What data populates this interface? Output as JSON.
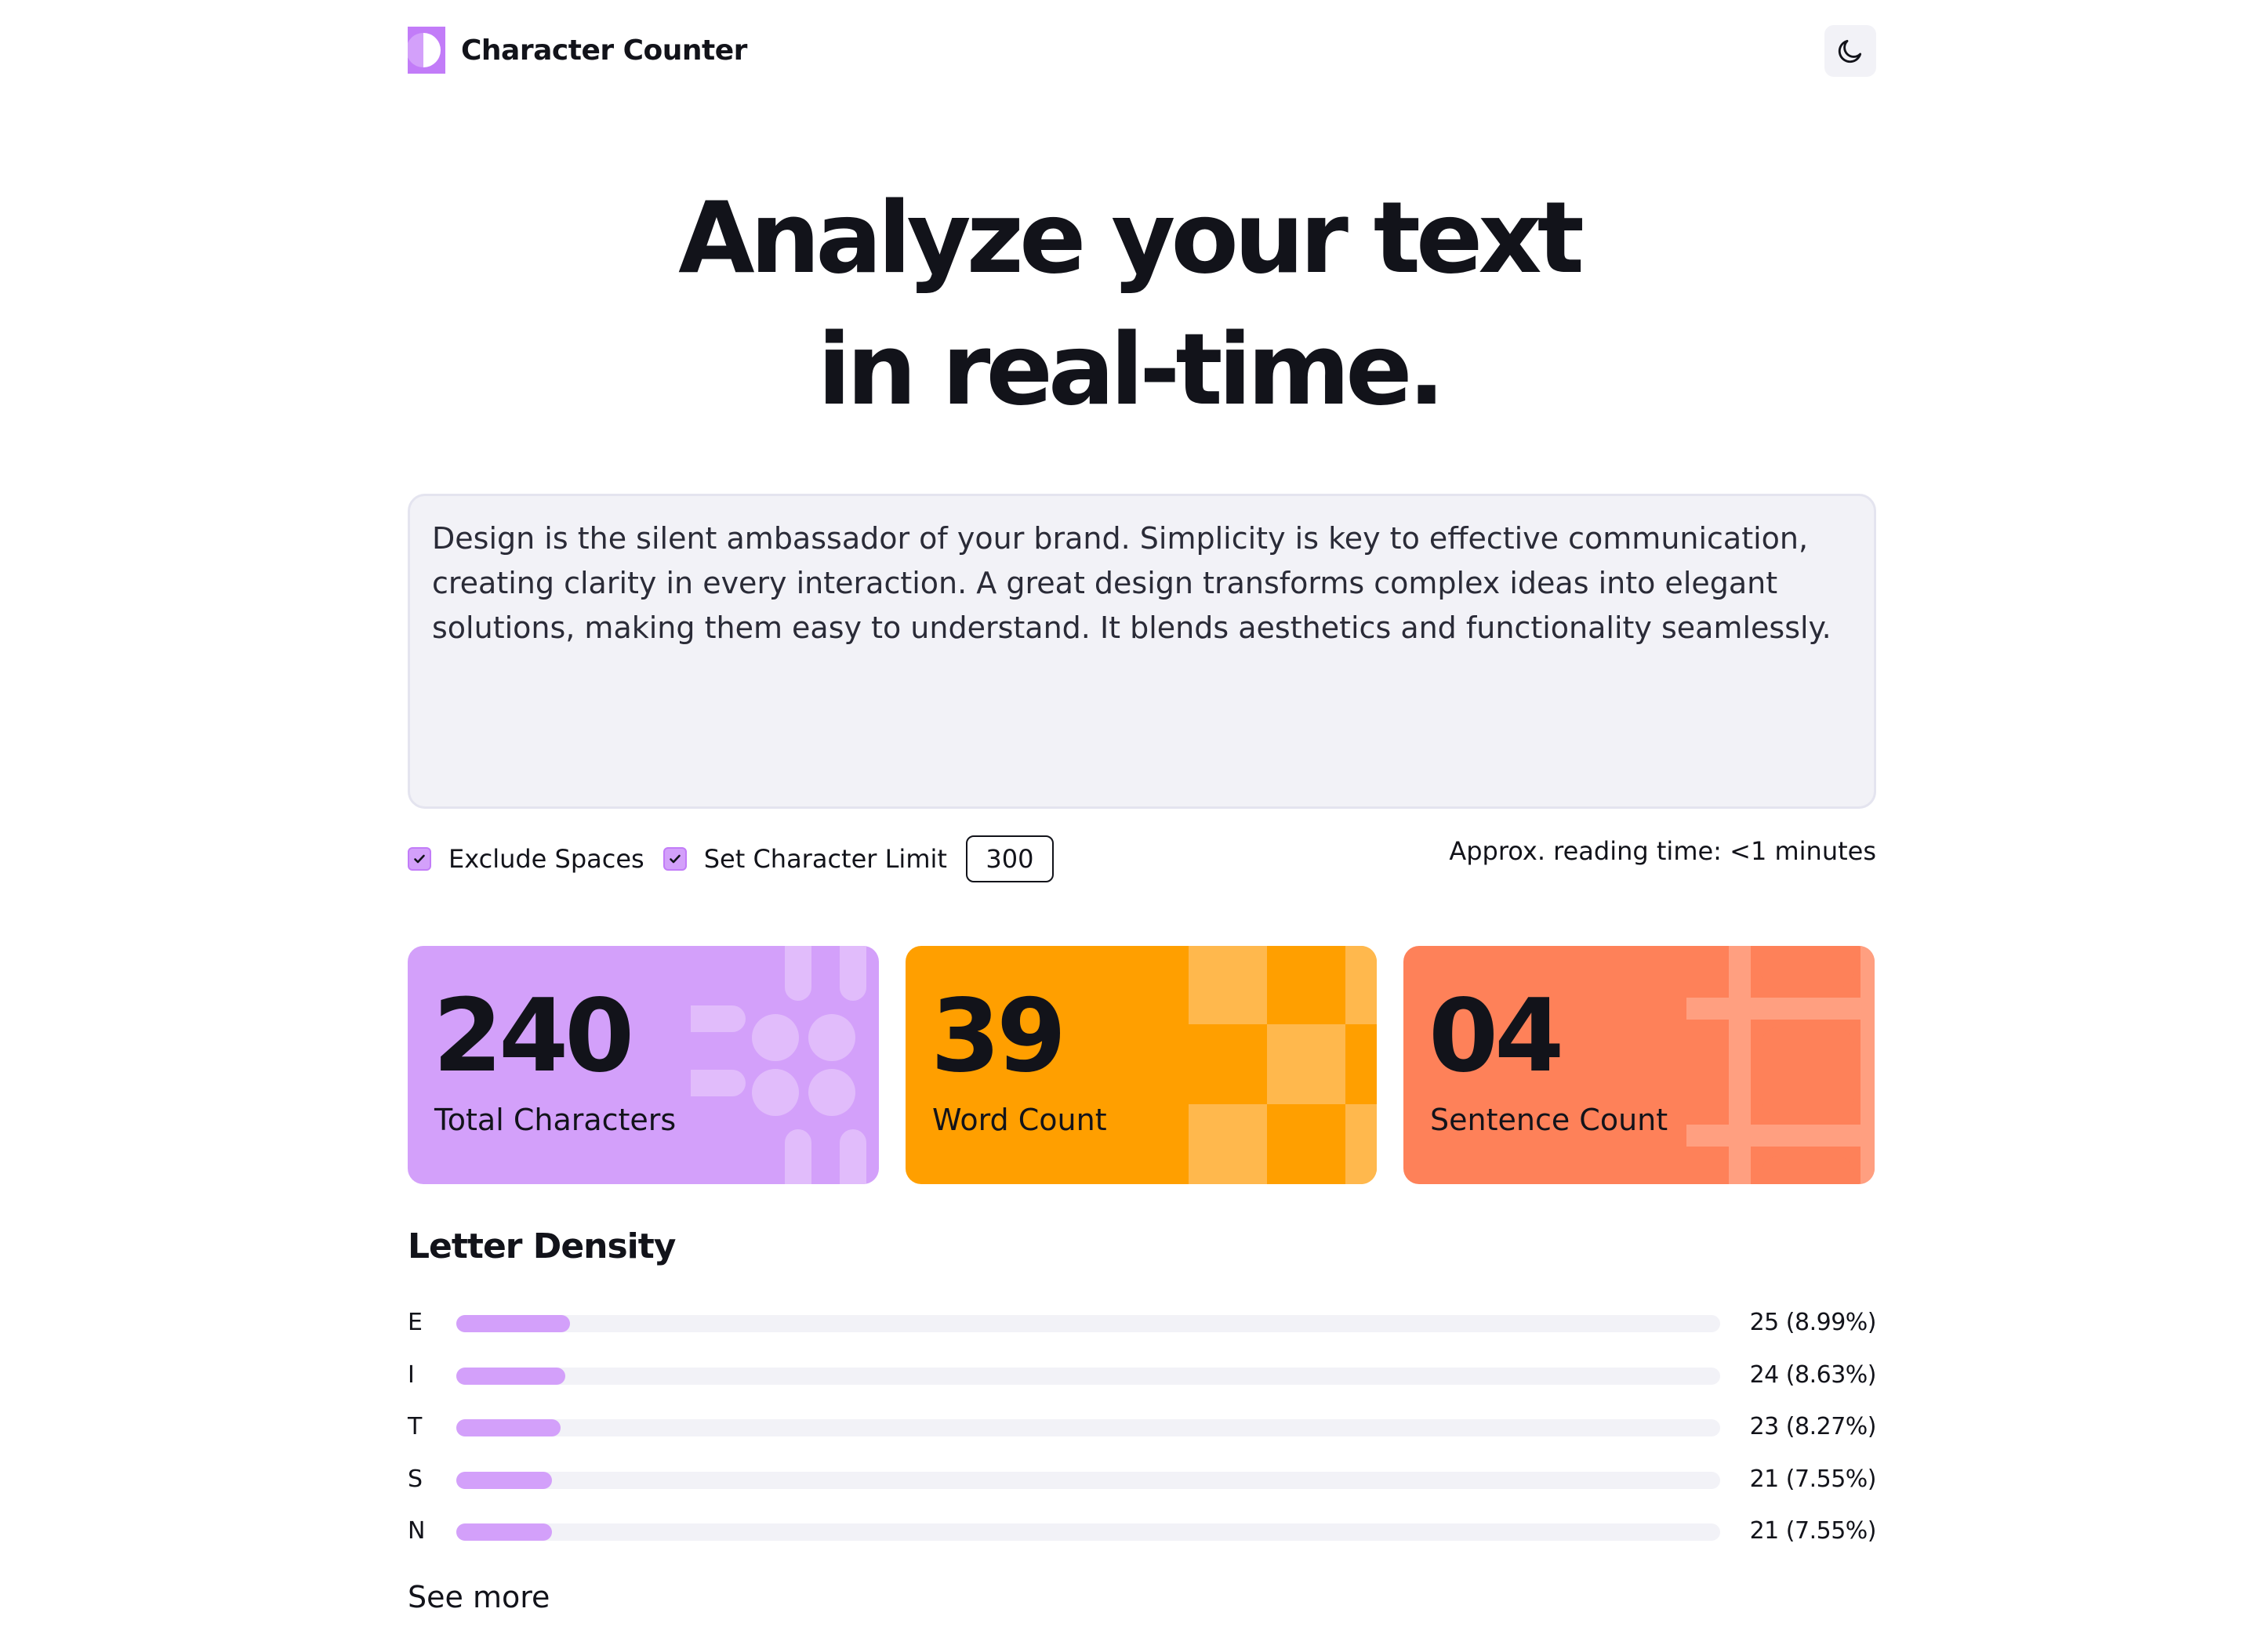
{
  "header": {
    "app_title": "Character Counter",
    "logo_icon": "half-moon-logo-icon",
    "theme_toggle_icon": "moon-icon"
  },
  "hero": {
    "line1": "Analyze your text",
    "line2": "in real-time."
  },
  "editor": {
    "text": "Design is the silent ambassador of your brand. Simplicity is key to effective communication, creating clarity in every interaction. A great design transforms complex ideas into elegant solutions, making them easy to understand. It blends aesthetics and functionality seamlessly."
  },
  "options": {
    "exclude_spaces_label": "Exclude Spaces",
    "exclude_spaces_checked": true,
    "char_limit_label": "Set Character Limit",
    "char_limit_checked": true,
    "char_limit_value": "300",
    "reading_time": "Approx. reading time: <1 minutes"
  },
  "stats": [
    {
      "value": "240",
      "label": "Total Characters",
      "color": "#d3a0fa"
    },
    {
      "value": "39",
      "label": "Word Count",
      "color": "#ff9f00"
    },
    {
      "value": "04",
      "label": "Sentence Count",
      "color": "#fe8159"
    }
  ],
  "density": {
    "title": "Letter Density",
    "fill_color": "#d3a0fa",
    "rows": [
      {
        "letter": "E",
        "count": "25 (8.99%)",
        "fraction": 0.0899
      },
      {
        "letter": "I",
        "count": "24 (8.63%)",
        "fraction": 0.0863
      },
      {
        "letter": "T",
        "count": "23 (8.27%)",
        "fraction": 0.0827
      },
      {
        "letter": "S",
        "count": "21 (7.55%)",
        "fraction": 0.0755
      },
      {
        "letter": "N",
        "count": "21 (7.55%)",
        "fraction": 0.0755
      }
    ],
    "see_more_label": "See more"
  }
}
